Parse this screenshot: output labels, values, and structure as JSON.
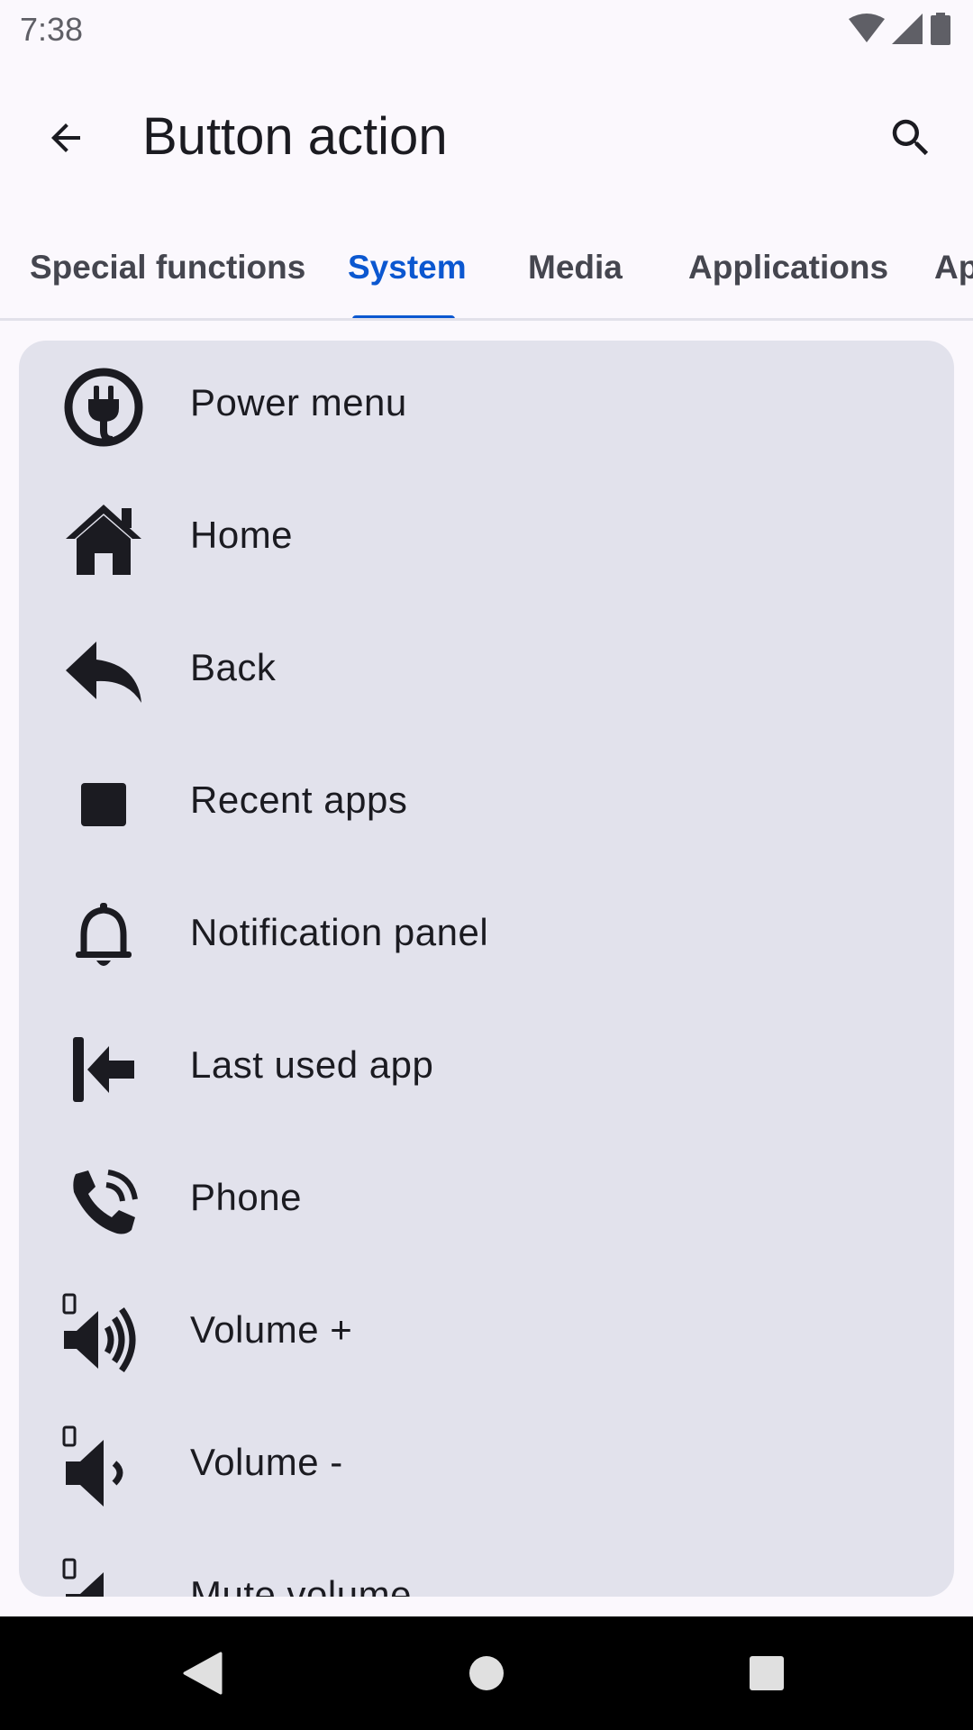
{
  "status_bar": {
    "time": "7:38"
  },
  "app_bar": {
    "title": "Button action"
  },
  "tabs": [
    {
      "label": "Special functions"
    },
    {
      "label": "System"
    },
    {
      "label": "Media"
    },
    {
      "label": "Applications"
    },
    {
      "label": "Ap"
    }
  ],
  "list": [
    {
      "label": "Power menu",
      "icon": "power-plug-icon"
    },
    {
      "label": "Home",
      "icon": "home-icon"
    },
    {
      "label": "Back",
      "icon": "reply-arrow-icon"
    },
    {
      "label": "Recent apps",
      "icon": "square-icon"
    },
    {
      "label": "Notification panel",
      "icon": "bell-icon"
    },
    {
      "label": "Last used app",
      "icon": "arrow-to-left-icon"
    },
    {
      "label": "Phone",
      "icon": "phone-icon"
    },
    {
      "label": "Volume +",
      "icon": "volume-up-icon"
    },
    {
      "label": "Volume -",
      "icon": "volume-down-icon"
    },
    {
      "label": "Mute volume",
      "icon": "volume-mute-icon"
    }
  ],
  "colors": {
    "accent": "#0b57d0",
    "card_background": "#e2e2ec",
    "page_background": "#fbf8fd"
  }
}
